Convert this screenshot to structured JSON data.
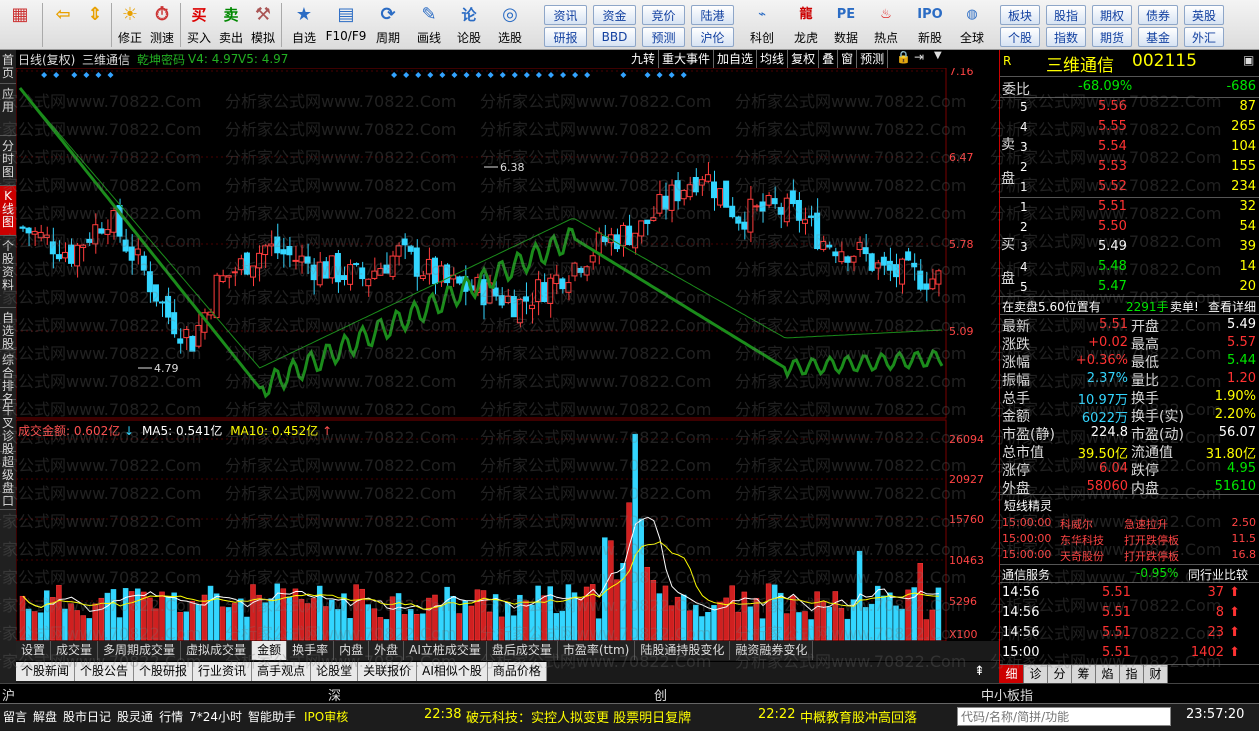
{
  "toolbar": {
    "buttons": [
      {
        "label": "",
        "icon": "grid-icon"
      },
      {
        "label": "",
        "icon": "back-arrow-icon"
      },
      {
        "label": "",
        "icon": "up-down-arrows-icon"
      },
      {
        "label": "修正",
        "icon": "correct-icon"
      },
      {
        "label": "测速",
        "icon": "clock-icon"
      },
      {
        "label": "买入",
        "icon": "buy-icon"
      },
      {
        "label": "卖出",
        "icon": "sell-icon"
      },
      {
        "label": "模拟",
        "icon": "hammer-icon"
      },
      {
        "label": "自选",
        "icon": "star-folder-icon"
      },
      {
        "label": "F10/F9",
        "icon": "f10-icon"
      },
      {
        "label": "周期",
        "icon": "cycle-icon"
      },
      {
        "label": "画线",
        "icon": "pen-icon"
      },
      {
        "label": "论股",
        "icon": "lun-icon"
      },
      {
        "label": "选股",
        "icon": "chart-search-icon"
      }
    ],
    "chips_row1": [
      "资讯",
      "资金",
      "竞价",
      "陆港"
    ],
    "chips_row2": [
      "研报",
      "BBD",
      "预测",
      "沪伦"
    ],
    "buttons2": [
      {
        "label": "科创",
        "icon": "kechuang-icon"
      },
      {
        "label": "龙虎",
        "icon": "dragon-icon"
      },
      {
        "label": "数据",
        "icon": "pe-icon"
      },
      {
        "label": "热点",
        "icon": "hot-icon"
      },
      {
        "label": "新股",
        "icon": "ipo-icon"
      },
      {
        "label": "全球",
        "icon": "globe-icon"
      }
    ],
    "chips2_row1": [
      "板块",
      "股指",
      "期权",
      "债券",
      "英股"
    ],
    "chips2_row2": [
      "个股",
      "指数",
      "期货",
      "基金",
      "外汇"
    ]
  },
  "left_tabs": [
    "首页",
    "应用",
    "分时图",
    "K线图",
    "个股资料",
    "自选股",
    "综合排名",
    "牛叉诊股",
    "超级盘口"
  ],
  "chart_header": {
    "period": "日线(复权)",
    "name": "三维通信",
    "indicator": "乾坤密码",
    "v4": "V4: 4.97",
    "v5": "V5: 4.97",
    "buttons": [
      "九转",
      "重大事件",
      "加自选",
      "均线",
      "复权",
      "叠",
      "窗",
      "预测"
    ]
  },
  "volume_header": {
    "amount": "成交金额: 0.602亿",
    "ma5": "MA5: 0.541亿",
    "ma10": "MA10: 0.452亿"
  },
  "chart_data": [
    {
      "type": "line",
      "title": "",
      "y_ticks": [
        "7.16",
        "6.47",
        "5.78",
        "5.09"
      ],
      "annotations": [
        {
          "label": "6.38"
        },
        {
          "label": "4.79"
        }
      ],
      "ylim": [
        4.4,
        7.16
      ]
    },
    {
      "type": "bar",
      "title": "成交金额",
      "y_ticks": [
        "26094",
        "20927",
        "15760",
        "10463",
        "5296",
        "X100"
      ],
      "ylim": [
        0,
        27000
      ]
    }
  ],
  "bottom_tabs1": [
    "设置",
    "成交量",
    "多周期成交量",
    "虚拟成交量",
    "金额",
    "换手率",
    "内盘",
    "外盘",
    "AI立桩成交量",
    "盘后成交量",
    "市盈率(ttm)",
    "陆股通持股变化",
    "融资融券变化"
  ],
  "bottom_tabs2": [
    "个股新闻",
    "个股公告",
    "个股研报",
    "行业资讯",
    "高手观点",
    "论股堂",
    "关联报价",
    "AI相似个股",
    "商品价格"
  ],
  "right": {
    "r_label": "R",
    "stock_name": "三维通信",
    "stock_code": "002115",
    "weibi_label": "委比",
    "weibi": "-68.09%",
    "weicha": "-686",
    "sell_label": "卖盘",
    "buy_label": "买盘",
    "sells": [
      {
        "lv": "5",
        "price": "5.56",
        "vol": "87"
      },
      {
        "lv": "4",
        "price": "5.55",
        "vol": "265"
      },
      {
        "lv": "3",
        "price": "5.54",
        "vol": "104"
      },
      {
        "lv": "2",
        "price": "5.53",
        "vol": "155"
      },
      {
        "lv": "1",
        "price": "5.52",
        "vol": "234"
      }
    ],
    "buys": [
      {
        "lv": "1",
        "price": "5.51",
        "vol": "32"
      },
      {
        "lv": "2",
        "price": "5.50",
        "vol": "54"
      },
      {
        "lv": "3",
        "price": "5.49",
        "vol": "39"
      },
      {
        "lv": "4",
        "price": "5.48",
        "vol": "14"
      },
      {
        "lv": "5",
        "price": "5.47",
        "vol": "20"
      }
    ],
    "notice": "在卖盘5.60位置有",
    "notice_vol": "2291手",
    "notice_action": "卖单!",
    "notice_link": "查看详细",
    "quotes": [
      {
        "k1": "最新",
        "v1": "5.51",
        "c1": "red",
        "k2": "开盘",
        "v2": "5.49",
        "c2": "wht"
      },
      {
        "k1": "涨跌",
        "v1": "+0.02",
        "c1": "red",
        "k2": "最高",
        "v2": "5.57",
        "c2": "red"
      },
      {
        "k1": "涨幅",
        "v1": "+0.36%",
        "c1": "red",
        "k2": "最低",
        "v2": "5.44",
        "c2": "grn"
      },
      {
        "k1": "振幅",
        "v1": "2.37%",
        "c1": "cyan",
        "k2": "量比",
        "v2": "1.20",
        "c2": "red"
      },
      {
        "k1": "总手",
        "v1": "10.97万",
        "c1": "cyan",
        "k2": "换手",
        "v2": "1.90%",
        "c2": "yel"
      },
      {
        "k1": "金额",
        "v1": "6022万",
        "c1": "cyan",
        "k2": "换手(实)",
        "v2": "2.20%",
        "c2": "yel"
      },
      {
        "k1": "市盈(静)",
        "v1": "224.8",
        "c1": "wht",
        "k2": "市盈(动)",
        "v2": "56.07",
        "c2": "wht"
      },
      {
        "k1": "总市值",
        "v1": "39.50亿",
        "c1": "yel",
        "k2": "流通值",
        "v2": "31.80亿",
        "c2": "yel"
      },
      {
        "k1": "涨停",
        "v1": "6.04",
        "c1": "red",
        "k2": "跌停",
        "v2": "4.95",
        "c2": "grn"
      },
      {
        "k1": "外盘",
        "v1": "58060",
        "c1": "red",
        "k2": "内盘",
        "v2": "51610",
        "c2": "grn"
      }
    ],
    "short_title": "短线精灵",
    "short_items": [
      {
        "time": "15:00:00",
        "name": "科威尔",
        "event": "急速拉升",
        "val": "2.50"
      },
      {
        "time": "15:00:00",
        "name": "东华科技",
        "event": "打开跌停板",
        "val": "11.5"
      },
      {
        "time": "15:00:00",
        "name": "天奇股份",
        "event": "打开跌停板",
        "val": "16.8"
      }
    ],
    "sector_name": "通信服务",
    "sector_chg": "-0.95%",
    "sector_cmp": "同行业比较",
    "ticks": [
      {
        "time": "14:56",
        "price": "5.51",
        "vol": "37"
      },
      {
        "time": "14:56",
        "price": "5.51",
        "vol": "8"
      },
      {
        "time": "14:56",
        "price": "5.51",
        "vol": "23"
      },
      {
        "time": "15:00",
        "price": "5.51",
        "vol": "1402"
      }
    ],
    "bottom_tabs": [
      "细",
      "诊",
      "分",
      "筹",
      "焰",
      "指",
      "财"
    ]
  },
  "index_bar": {
    "sh": "沪",
    "sz": "深",
    "cy": "创",
    "zxb": "中小板指"
  },
  "status": {
    "items": [
      "留言",
      "解盘",
      "股市日记",
      "股灵通",
      "行情",
      "7*24小时",
      "智能助手"
    ],
    "ipo": "IPO审核",
    "news1_time": "22:38",
    "news1": "破元科技：实控人拟变更 股票明日复牌",
    "news2_time": "22:22",
    "news2": "中概教育股冲高回落",
    "search_placeholder": "代码/名称/简拼/功能",
    "clock": "23:57:20"
  },
  "watermark": "分析家公式网www.70822.Com"
}
